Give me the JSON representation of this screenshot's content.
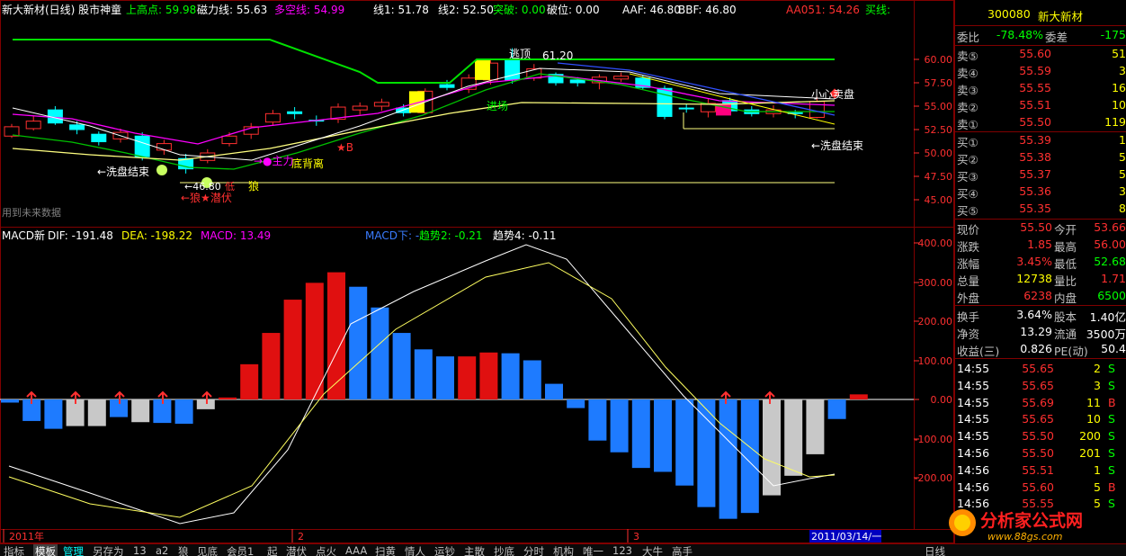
{
  "main_header": {
    "title": "新大新材(日线) 股市神童",
    "items": [
      {
        "label": "上高点: 59.98",
        "color": "#00ff00"
      },
      {
        "label": "磁力线: 55.63",
        "color": "#ffffff"
      },
      {
        "label": "多空线: 54.99",
        "color": "#ff00ff"
      },
      {
        "label": "线1: 51.78",
        "color": "#ffffff"
      },
      {
        "label": "线2: 52.50",
        "color": "#ffffff"
      },
      {
        "label": "突破: 0.00",
        "color": "#00ff00"
      },
      {
        "label": "破位: 0.00",
        "color": "#ffffff"
      },
      {
        "label": "AAF: 46.80",
        "color": "#ffffff"
      },
      {
        "label": "BBF: 46.80",
        "color": "#ffffff"
      },
      {
        "label": "AA051: 54.26",
        "color": "#ff3030"
      },
      {
        "label": "买线:",
        "color": "#00ff00"
      }
    ]
  },
  "price_axis": [
    "60.00",
    "57.50",
    "55.00",
    "52.50",
    "50.00",
    "47.50",
    "45.00"
  ],
  "price_annotations": {
    "escape_top": "逃顶",
    "escape_price": "61.20",
    "entry": "进场",
    "warn_sell": "小心卖盘",
    "wash_end_left": "←洗盘结束",
    "wash_end_right": "←洗盘结束",
    "low_price": "←46.80",
    "b_mark": "★B",
    "main_force": "→●主力",
    "bottom_div": "底背离",
    "wolf": "狼",
    "wolf_hide": "←狼★潜伏",
    "future_data": "用到未来数据",
    "low_tag": "低"
  },
  "macd_header": {
    "title": "MACD新",
    "items": [
      {
        "label": "DIF: -191.48",
        "color": "#ffffff"
      },
      {
        "label": "DEA: -198.22",
        "color": "#ffff00"
      },
      {
        "label": "MACD: 13.49",
        "color": "#ff00ff"
      },
      {
        "label": "MACD下: -",
        "color": "#3a7cff"
      },
      {
        "label": "趋势2: -0.21",
        "color": "#00ff00"
      },
      {
        "label": "趋势4: -0.11",
        "color": "#ffffff"
      }
    ]
  },
  "macd_axis": [
    "400.00",
    "300.00",
    "200.00",
    "100.00",
    "0.00",
    "-100.00",
    "-200.00"
  ],
  "time_axis": {
    "labels": [
      "2011年",
      "2",
      "3"
    ],
    "cursor_date": "2011/03/14/一"
  },
  "quote": {
    "code": "300080",
    "name": "新大新材",
    "webi_label": "委比",
    "webi_value": "-78.48%",
    "weicha_label": "委差",
    "weicha_value": "-175",
    "asks": [
      {
        "label": "卖⑤",
        "price": "55.60",
        "vol": "51"
      },
      {
        "label": "卖④",
        "price": "55.59",
        "vol": "3"
      },
      {
        "label": "卖③",
        "price": "55.55",
        "vol": "16"
      },
      {
        "label": "卖②",
        "price": "55.51",
        "vol": "10"
      },
      {
        "label": "卖①",
        "price": "55.50",
        "vol": "119"
      }
    ],
    "bids": [
      {
        "label": "买①",
        "price": "55.39",
        "vol": "1"
      },
      {
        "label": "买②",
        "price": "55.38",
        "vol": "5"
      },
      {
        "label": "买③",
        "price": "55.37",
        "vol": "5"
      },
      {
        "label": "买④",
        "price": "55.36",
        "vol": "3"
      },
      {
        "label": "买⑤",
        "price": "55.35",
        "vol": "8"
      }
    ],
    "stats": [
      {
        "l1": "现价",
        "v1": "55.50",
        "c1": "#ff3030",
        "l2": "今开",
        "v2": "53.66",
        "c2": "#ff3030"
      },
      {
        "l1": "涨跌",
        "v1": "1.85",
        "c1": "#ff3030",
        "l2": "最高",
        "v2": "56.00",
        "c2": "#ff3030"
      },
      {
        "l1": "涨幅",
        "v1": "3.45%",
        "c1": "#ff3030",
        "l2": "最低",
        "v2": "52.68",
        "c2": "#00ff00"
      },
      {
        "l1": "总量",
        "v1": "12738",
        "c1": "#ffff00",
        "l2": "量比",
        "v2": "1.71",
        "c2": "#ff3030"
      },
      {
        "l1": "外盘",
        "v1": "6238",
        "c1": "#ff3030",
        "l2": "内盘",
        "v2": "6500",
        "c2": "#00ff00"
      }
    ],
    "stats2": [
      {
        "l1": "换手",
        "v1": "3.64%",
        "l2": "股本",
        "v2": "1.40亿"
      },
      {
        "l1": "净资",
        "v1": "13.29",
        "l2": "流通",
        "v2": "3500万"
      },
      {
        "l1": "收益(三)",
        "v1": "0.826",
        "l2": "PE(动)",
        "v2": "50.4"
      }
    ],
    "ticks": [
      {
        "time": "14:55",
        "price": "55.65",
        "vol": "2",
        "side": "S"
      },
      {
        "time": "14:55",
        "price": "55.65",
        "vol": "3",
        "side": "S"
      },
      {
        "time": "14:55",
        "price": "55.69",
        "vol": "11",
        "side": "B"
      },
      {
        "time": "14:55",
        "price": "55.65",
        "vol": "10",
        "side": "S"
      },
      {
        "time": "14:55",
        "price": "55.50",
        "vol": "200",
        "side": "S"
      },
      {
        "time": "14:56",
        "price": "55.50",
        "vol": "201",
        "side": "S"
      },
      {
        "time": "14:56",
        "price": "55.51",
        "vol": "1",
        "side": "S"
      },
      {
        "time": "14:56",
        "price": "55.60",
        "vol": "5",
        "side": "B"
      },
      {
        "time": "14:56",
        "price": "55.55",
        "vol": "5",
        "side": "S"
      }
    ]
  },
  "bottom_tabs": [
    "指标",
    "模板",
    "管理",
    "另存为",
    "13",
    "a2",
    "狼",
    "见底",
    "会员1",
    "起",
    "潜伏",
    "点火",
    "AAA",
    "扫黄",
    "情人",
    "运钞",
    "主散",
    "抄底",
    "分时",
    "机构",
    "唯一",
    "123",
    "大牛",
    "高手"
  ],
  "bottom_right_tab": "日线",
  "watermark": {
    "title": "分析家公式网",
    "url": "www.88gs.com"
  },
  "colors": {
    "up": "#ff3030",
    "down": "#00ffff",
    "grid": "#800000",
    "axis": "#ff3030",
    "macd_pos": "#e01010",
    "macd_neg": "#1e7bff",
    "macd_neutral": "#c8c8c8"
  }
}
